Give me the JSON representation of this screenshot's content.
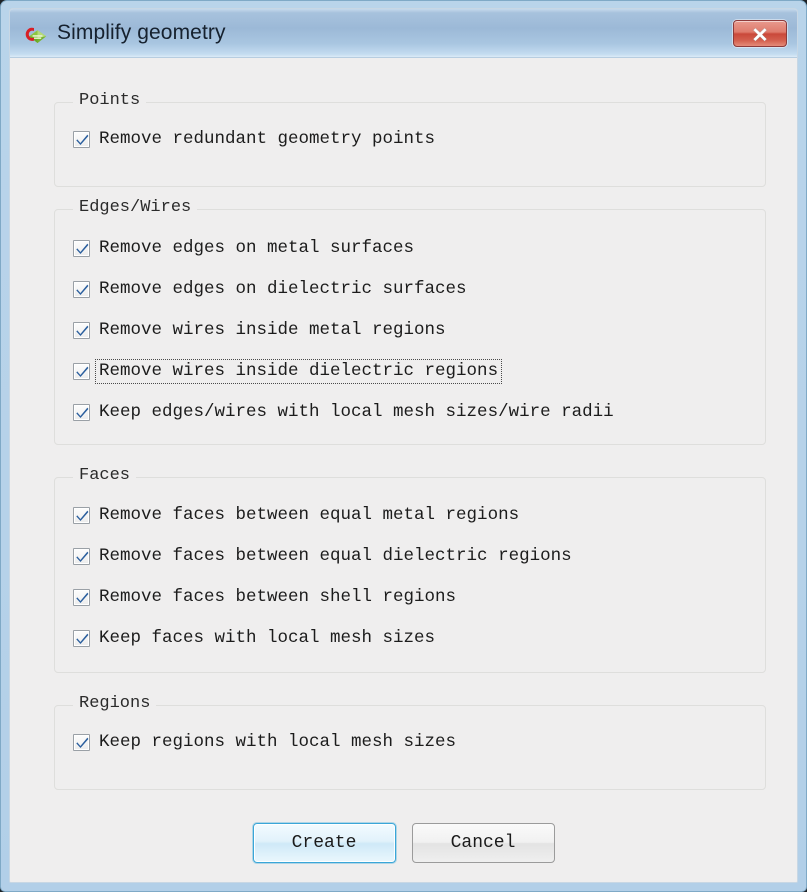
{
  "window": {
    "title": "Simplify geometry",
    "icon": "cst-application-icon",
    "close_label": "✕"
  },
  "groups": [
    {
      "id": "points",
      "title": "Points",
      "items": [
        {
          "label": "Remove redundant geometry points",
          "checked": true,
          "focused": false
        }
      ]
    },
    {
      "id": "edges-wires",
      "title": "Edges/Wires",
      "items": [
        {
          "label": "Remove edges on metal surfaces",
          "checked": true,
          "focused": false
        },
        {
          "label": "Remove edges on dielectric surfaces",
          "checked": true,
          "focused": false
        },
        {
          "label": "Remove wires inside metal regions",
          "checked": true,
          "focused": false
        },
        {
          "label": "Remove wires inside dielectric regions",
          "checked": true,
          "focused": true
        },
        {
          "label": "Keep edges/wires with local mesh sizes/wire radii",
          "checked": true,
          "focused": false
        }
      ]
    },
    {
      "id": "faces",
      "title": "Faces",
      "items": [
        {
          "label": "Remove faces between equal metal regions",
          "checked": true,
          "focused": false
        },
        {
          "label": "Remove faces between equal dielectric regions",
          "checked": true,
          "focused": false
        },
        {
          "label": "Remove faces between shell regions",
          "checked": true,
          "focused": false
        },
        {
          "label": "Keep faces with local mesh sizes",
          "checked": true,
          "focused": false
        }
      ]
    },
    {
      "id": "regions",
      "title": "Regions",
      "items": [
        {
          "label": "Keep regions with local mesh sizes",
          "checked": true,
          "focused": false
        }
      ]
    }
  ],
  "buttons": {
    "create_label": "Create",
    "cancel_label": "Cancel"
  },
  "colors": {
    "titlebar_top": "#c5d9ec",
    "titlebar_bottom": "#dbeaf7",
    "frame": "#b6d2e9",
    "dialog_bg": "#efeeee",
    "close_red": "#c9483a",
    "default_button_border": "#3aa6d8",
    "check_blue": "#2b5f9e"
  }
}
